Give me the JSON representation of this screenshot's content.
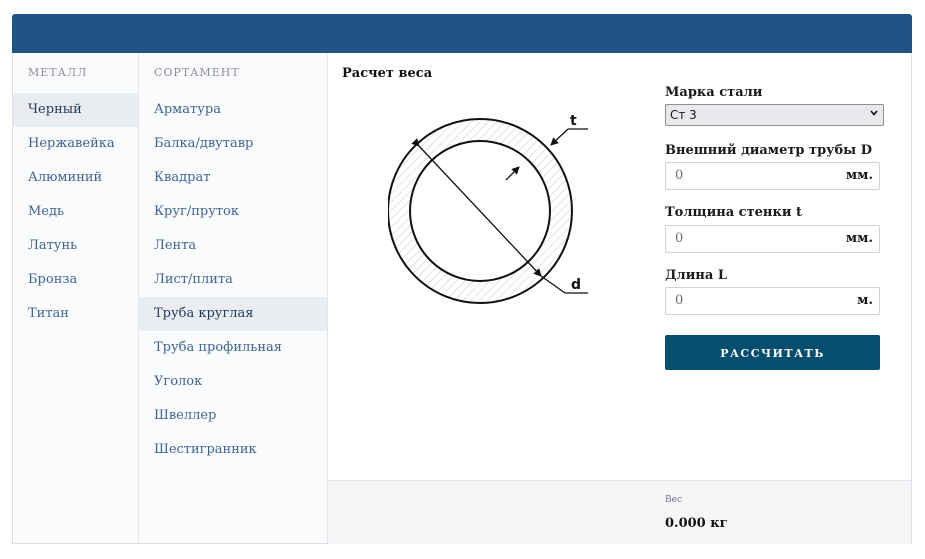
{
  "metal": {
    "heading": "МЕТАЛЛ",
    "items": [
      {
        "label": "Черный",
        "active": true
      },
      {
        "label": "Нержавейка",
        "active": false
      },
      {
        "label": "Алюминий",
        "active": false
      },
      {
        "label": "Медь",
        "active": false
      },
      {
        "label": "Латунь",
        "active": false
      },
      {
        "label": "Бронза",
        "active": false
      },
      {
        "label": "Титан",
        "active": false
      }
    ]
  },
  "assortment": {
    "heading": "СОРТАМЕНТ",
    "items": [
      {
        "label": "Арматура",
        "active": false
      },
      {
        "label": "Балка/двутавр",
        "active": false
      },
      {
        "label": "Квадрат",
        "active": false
      },
      {
        "label": "Круг/пруток",
        "active": false
      },
      {
        "label": "Лента",
        "active": false
      },
      {
        "label": "Лист/плита",
        "active": false
      },
      {
        "label": "Труба круглая",
        "active": true
      },
      {
        "label": "Труба профильная",
        "active": false
      },
      {
        "label": "Уголок",
        "active": false
      },
      {
        "label": "Швеллер",
        "active": false
      },
      {
        "label": "Шестигранник",
        "active": false
      }
    ]
  },
  "calc": {
    "title": "Расчет веса",
    "diagram": {
      "label_t": "t",
      "label_d": "d"
    },
    "steel_grade": {
      "label": "Марка стали",
      "value": "Ст 3"
    },
    "outer_diameter": {
      "label": "Внешний диаметр трубы D",
      "value": "0",
      "unit": "мм."
    },
    "wall_thickness": {
      "label": "Толщина стенки t",
      "value": "0",
      "unit": "мм."
    },
    "length": {
      "label": "Длина L",
      "value": "0",
      "unit": "м."
    },
    "button": "РАССЧИТАТЬ",
    "result": {
      "label": "Вес",
      "value": "0.000 кг"
    }
  },
  "colors": {
    "header": "#1f5485",
    "button": "#064e6e",
    "link": "#3e6590",
    "active_bg": "#e9edf2"
  }
}
